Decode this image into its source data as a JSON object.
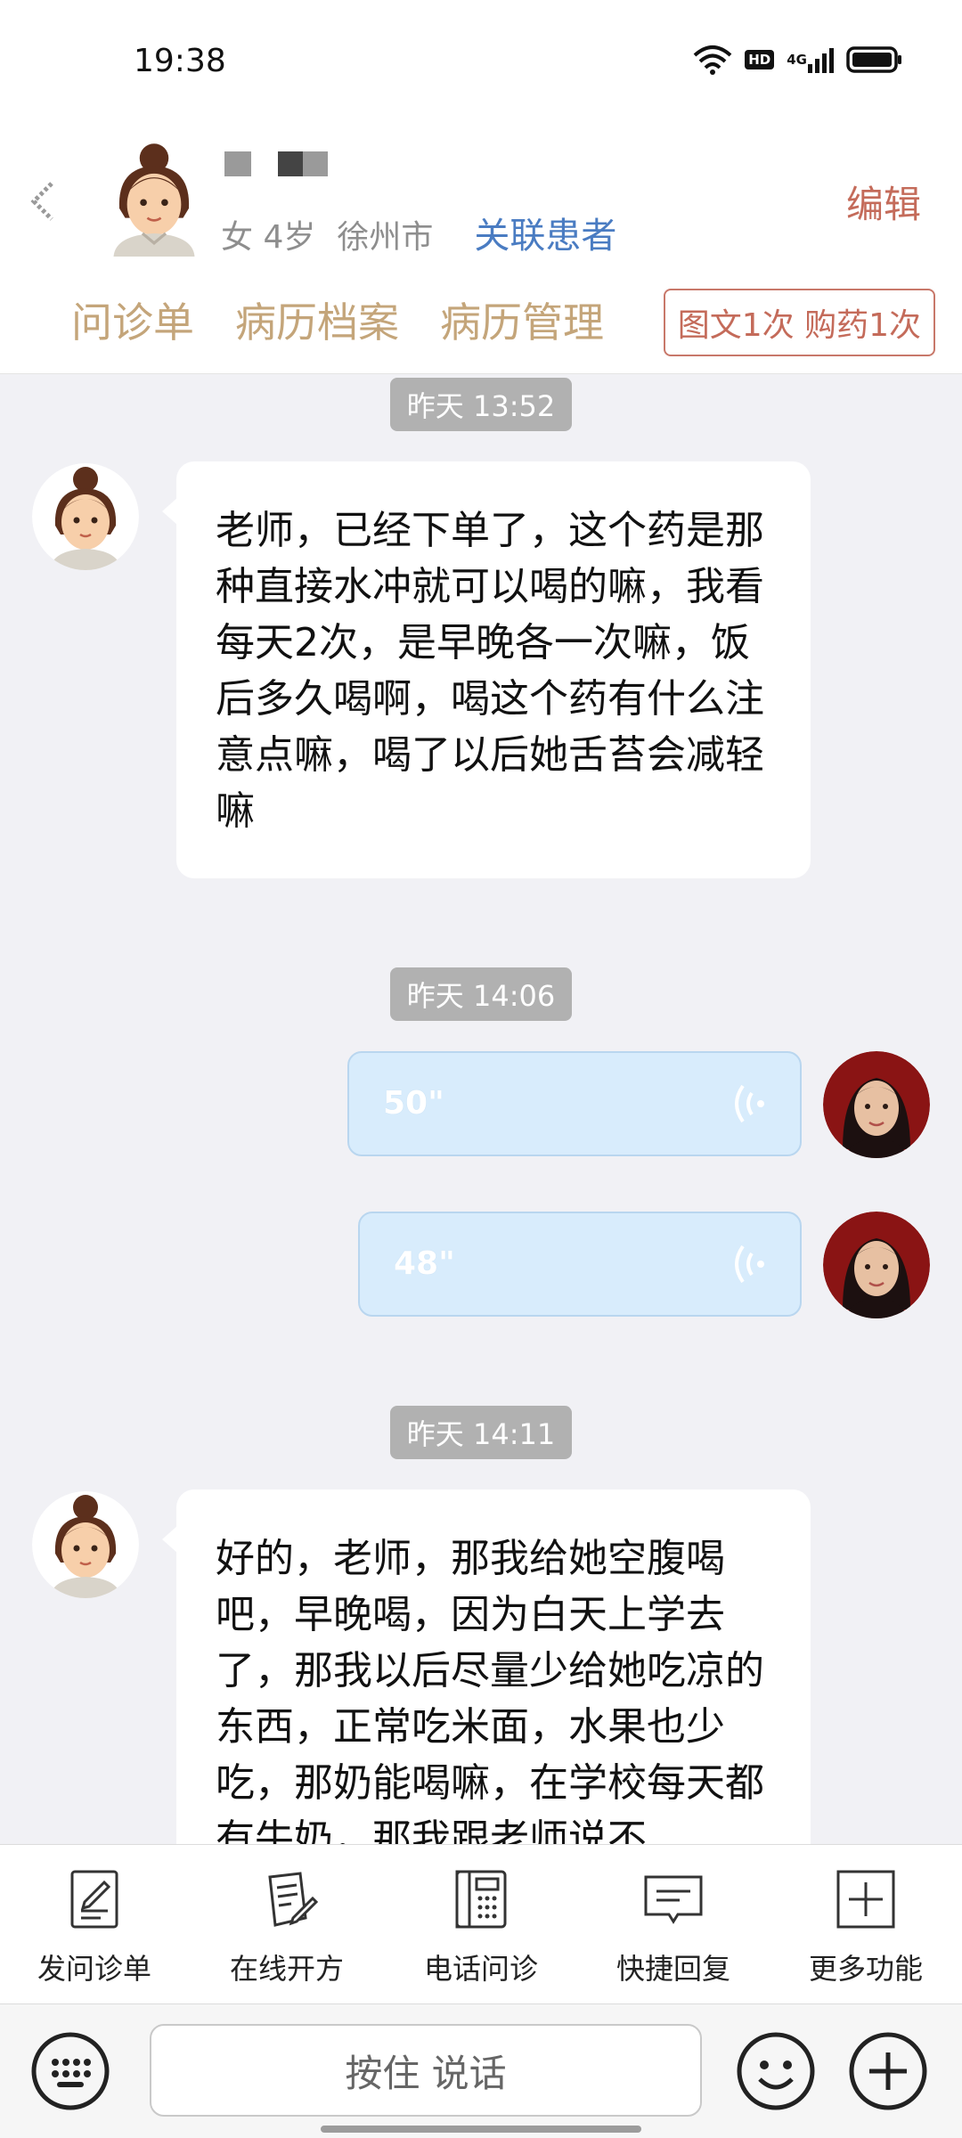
{
  "status_bar": {
    "time": "19:38",
    "icons": [
      "wifi-icon",
      "hd-icon",
      "signal-4g-icon",
      "battery-icon"
    ],
    "hd_label": "HD",
    "network_label": "4G"
  },
  "header": {
    "gender": "女",
    "age": "4岁",
    "city": "徐州市",
    "link_patient": "关联患者",
    "edit": "编辑",
    "tabs": [
      "问诊单",
      "病历档案",
      "病历管理"
    ],
    "quota": "图文1次 购药1次"
  },
  "messages": {
    "time_1": "昨天 13:52",
    "msg_1": "老师，已经下单了，这个药是那种直接水冲就可以喝的嘛，我看每天2次，是早晚各一次嘛，饭后多久喝啊，喝这个药有什么注意点嘛，喝了以后她舌苔会减轻嘛",
    "time_2": "昨天 14:06",
    "voice_1": "50\"",
    "voice_2": "48\"",
    "time_3": "昨天 14:11",
    "msg_2": "好的，老师，那我给她空腹喝吧，早晚喝，因为白天上学去了，那我以后尽量少给她吃凉的东西，正常吃米面，水果也少吃，那奶能喝嘛，在学校每天都有牛奶，那我跟老师说不"
  },
  "actions": [
    {
      "label": "发问诊单",
      "icon": "form-icon"
    },
    {
      "label": "在线开方",
      "icon": "prescription-icon"
    },
    {
      "label": "电话问诊",
      "icon": "phone-icon"
    },
    {
      "label": "快捷回复",
      "icon": "quick-reply-icon"
    },
    {
      "label": "更多功能",
      "icon": "plus-square-icon"
    }
  ],
  "input": {
    "hold_to_talk": "按住 说话"
  },
  "colors": {
    "accent_tab": "#c4a57a",
    "edit_red": "#c46b5a",
    "link_blue": "#4a7cc2",
    "voice_bubble": "#d8ecfc"
  }
}
